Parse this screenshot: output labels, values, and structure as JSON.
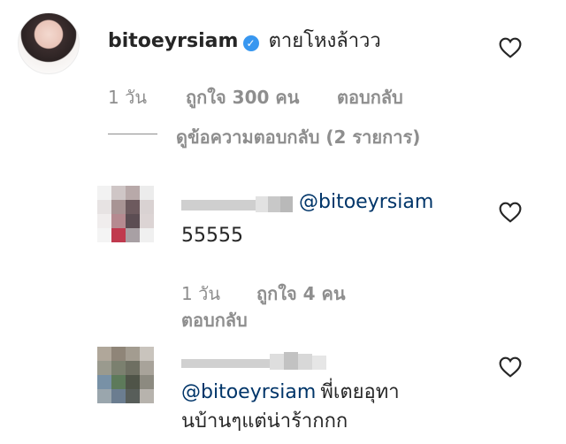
{
  "main_comment": {
    "username": "bitoeyrsiam",
    "text": "ตายโหงล้าวว",
    "time": "1 วัน",
    "likes": "ถูกใจ 300 คน",
    "reply_label": "ตอบกลับ",
    "view_replies": "ดูข้อความตอบกลับ (2 รายการ)"
  },
  "replies": [
    {
      "mention": "@bitoeyrsiam",
      "text": "55555",
      "time": "1 วัน",
      "likes": "ถูกใจ 4 คน",
      "reply_label": "ตอบกลับ"
    },
    {
      "mention": "@bitoeyrsiam",
      "text_line1": "พี่เตยอุทา",
      "text_line2": "นบ้านๆแต่น่าร้ากกก"
    }
  ],
  "icons": {
    "like": "heart-outline-icon",
    "verified": "verified-badge-icon"
  },
  "colors": {
    "text": "#262626",
    "meta": "#8e8e8e",
    "verified": "#3897f0",
    "mention": "#003569"
  }
}
